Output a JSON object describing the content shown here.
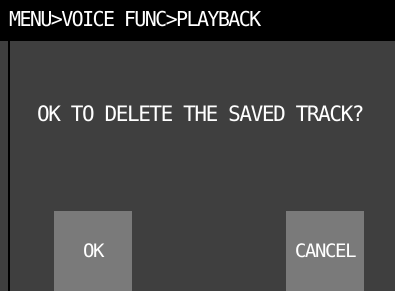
{
  "header": {
    "breadcrumb": "MENU>VOICE FUNC>PLAYBACK"
  },
  "dialog": {
    "message": "OK TO DELETE THE SAVED TRACK?",
    "ok_label": "OK",
    "cancel_label": "CANCEL"
  },
  "colors": {
    "title_background": "#000000",
    "screen_background": "#3f3f3f",
    "button_background": "#7a7a7a",
    "text": "#ffffff"
  }
}
